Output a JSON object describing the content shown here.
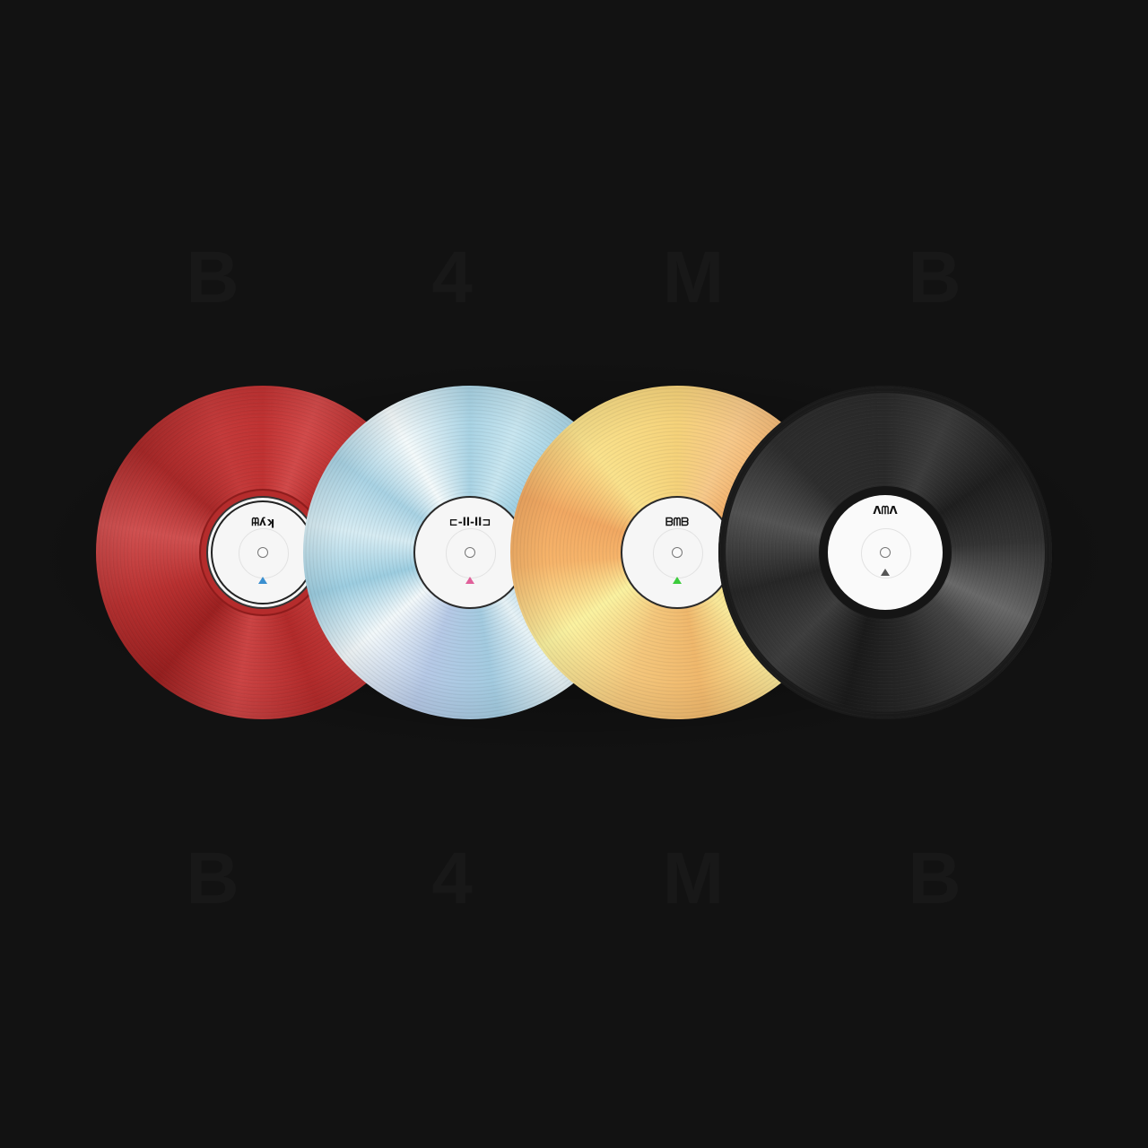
{
  "background_letters": {
    "top": [
      "B",
      "4",
      "M",
      "B"
    ],
    "bottom": [
      "B",
      "4",
      "M",
      "B"
    ]
  },
  "records": [
    {
      "name": "red-vinyl",
      "color": "#c03232",
      "logo": "ᗰ̶ʎʞ",
      "marker_color": "#3a8fd0",
      "marker_icon": "triangle-up-icon"
    },
    {
      "name": "blue-iridescent-vinyl",
      "color": "#a9d3e4",
      "logo": "⊏-ll-ll⊐",
      "marker_color": "#e0609a",
      "marker_icon": "triangle-up-icon"
    },
    {
      "name": "gold-vinyl",
      "color": "#f5d27a",
      "logo": "ᗷᗰᗷ",
      "marker_color": "#3ccc3c",
      "marker_icon": "triangle-up-icon"
    },
    {
      "name": "black-vinyl",
      "color": "#2a2a2a",
      "logo": "ᐱᗰᐱ",
      "marker_color": "#555555",
      "marker_icon": "triangle-up-icon"
    }
  ]
}
